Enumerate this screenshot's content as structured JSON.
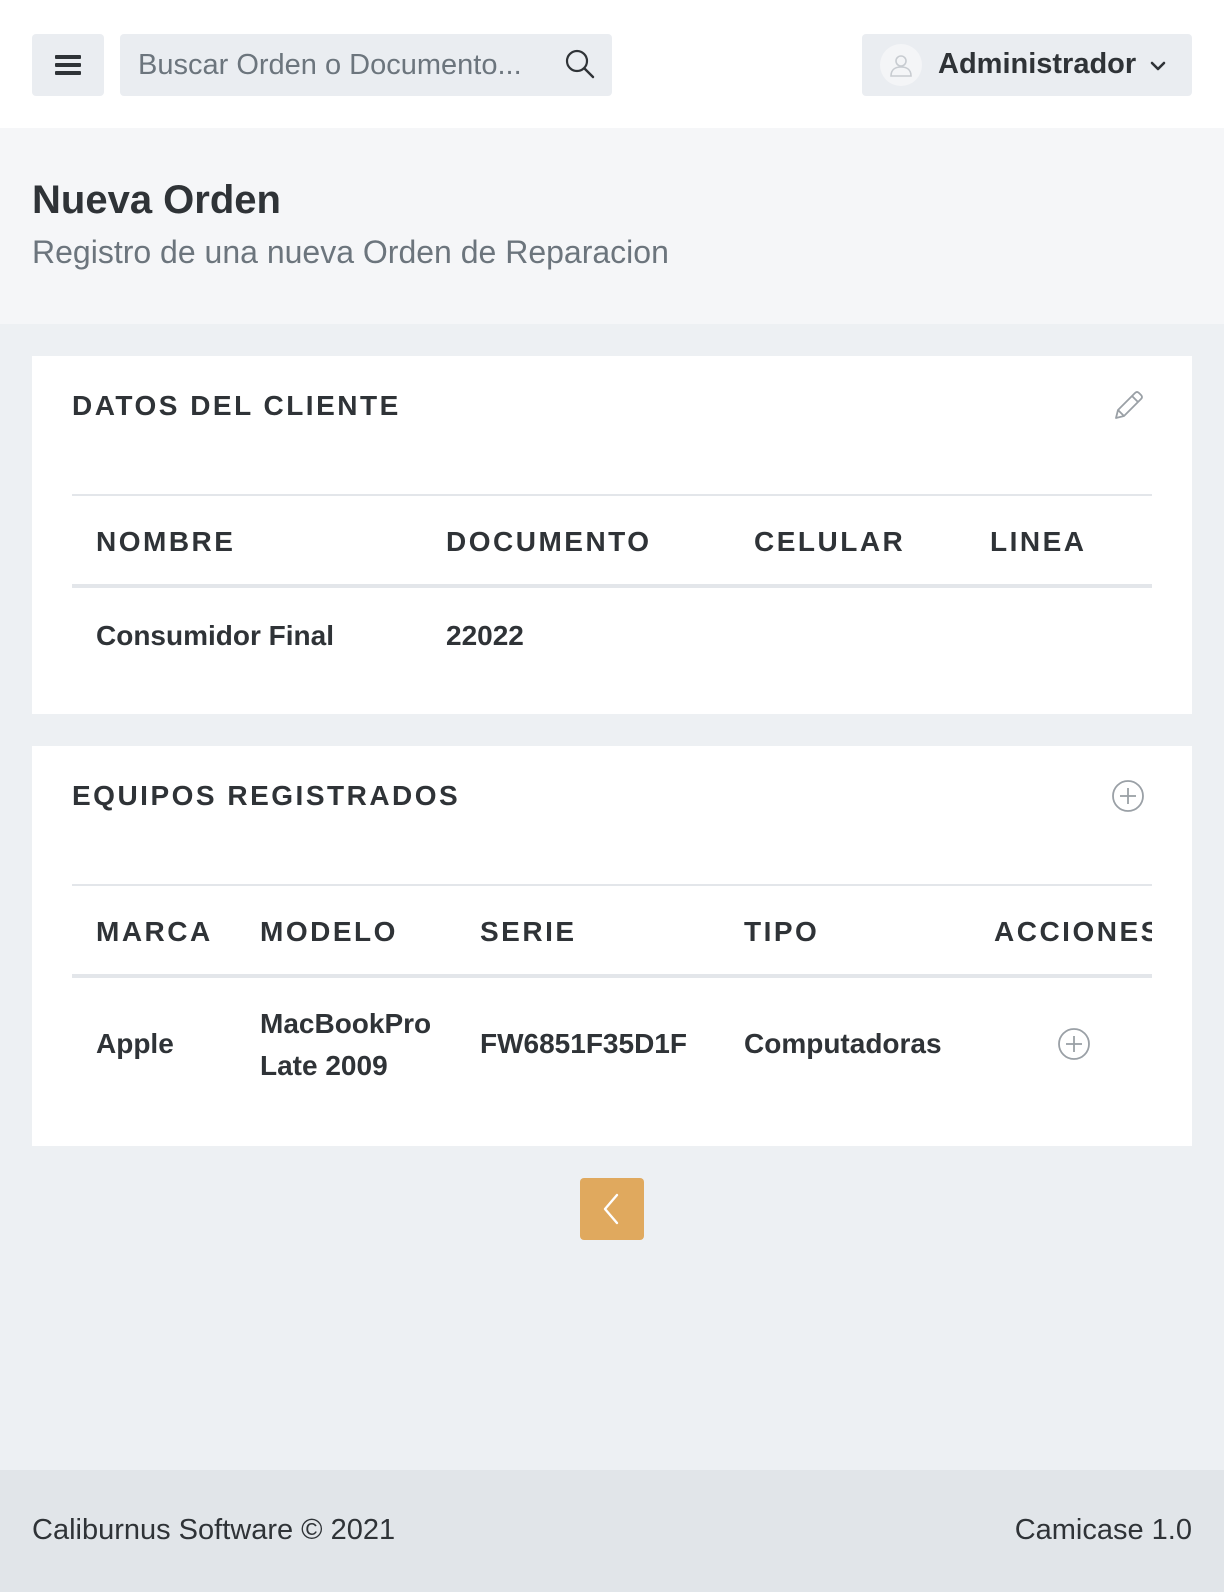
{
  "header": {
    "search_placeholder": "Buscar Orden o Documento...",
    "user_name": "Administrador"
  },
  "page": {
    "title": "Nueva Orden",
    "subtitle": "Registro de una nueva Orden de Reparacion"
  },
  "client_card": {
    "title": "DATOS DEL CLIENTE",
    "action_icon": "pencil-icon",
    "columns": [
      "NOMBRE",
      "DOCUMENTO",
      "CELULAR",
      "LINEA"
    ],
    "rows": [
      {
        "nombre": "Consumidor Final",
        "documento": "22022",
        "celular": "",
        "linea": ""
      }
    ]
  },
  "equipment_card": {
    "title": "EQUIPOS REGISTRADOS",
    "action_icon": "plus-circle-icon",
    "columns": [
      "MARCA",
      "MODELO",
      "SERIE",
      "TIPO",
      "ACCIONES"
    ],
    "rows": [
      {
        "marca": "Apple",
        "modelo_line1": "MacBookPro",
        "modelo_line2": "Late 2009",
        "serie": "FW6851F35D1F",
        "tipo": "Computadoras"
      }
    ]
  },
  "back_button": {
    "icon": "chevron-left-icon"
  },
  "footer": {
    "left": "Caliburnus Software © 2021",
    "right": "Camicase 1.0"
  },
  "colors": {
    "accent": "#e0a95e",
    "background": "#edf0f3",
    "footer": "#e1e5e9"
  }
}
